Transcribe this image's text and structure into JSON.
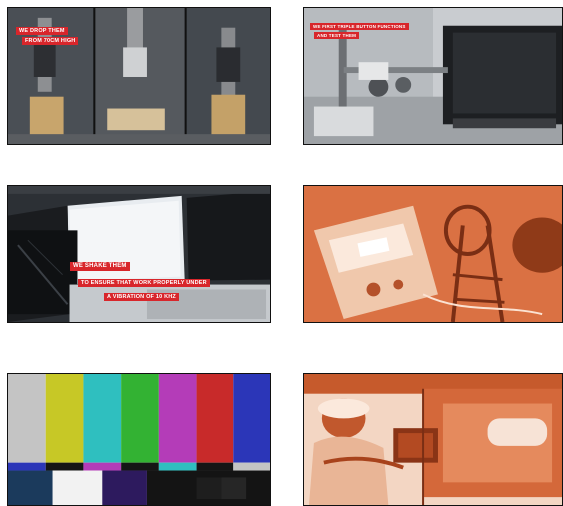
{
  "thumbnails": [
    {
      "captions": [
        "WE DROP THEM",
        "FROM 70CM HIGH"
      ]
    },
    {
      "captions": [
        "WE FIRST TRIPLE BUTTON FUNCTIONS",
        "AND TEST THEM"
      ]
    },
    {
      "captions": [
        "WE SHAKE THEM",
        "TO ENSURE THAT WORK PROPERLY UNDER",
        "A VIBRATION OF 10 KHZ"
      ]
    },
    {
      "captions": []
    },
    {
      "captions": []
    },
    {
      "captions": []
    }
  ],
  "colors": {
    "caption_red": "#d8262b",
    "duotone_orange": "#d4683a",
    "background": "#ffffff"
  }
}
